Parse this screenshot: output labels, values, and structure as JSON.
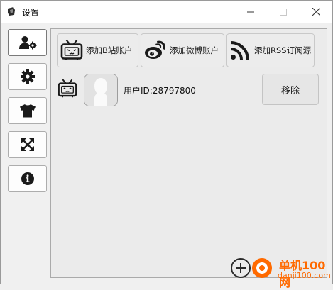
{
  "window": {
    "title": "设置",
    "controls": [
      "minimize-icon",
      "maximize-icon",
      "close-icon"
    ]
  },
  "sidebar": {
    "items": [
      {
        "icon": "user-gear-icon",
        "active": true
      },
      {
        "icon": "gear-icon",
        "active": false
      },
      {
        "icon": "tshirt-icon",
        "active": false
      },
      {
        "icon": "expand-arrows-icon",
        "active": false
      },
      {
        "icon": "info-icon",
        "active": false
      }
    ]
  },
  "toolbar": {
    "add_bilibili_label": "添加B站账户",
    "add_weibo_label": "添加微博账户",
    "add_rss_label": "添加RSS订阅源"
  },
  "account": {
    "platform_icon": "bilibili-tv-icon",
    "user_id_text": "用户ID:28797800",
    "remove_label": "移除"
  },
  "watermark": {
    "name": "单机100网",
    "url": "danji100.com"
  },
  "colors": {
    "window_bg": "#f0f0f0",
    "panel_bg": "#ebebeb",
    "icon_dark": "#1a1a1a",
    "watermark_orange": "#ff6a00"
  }
}
